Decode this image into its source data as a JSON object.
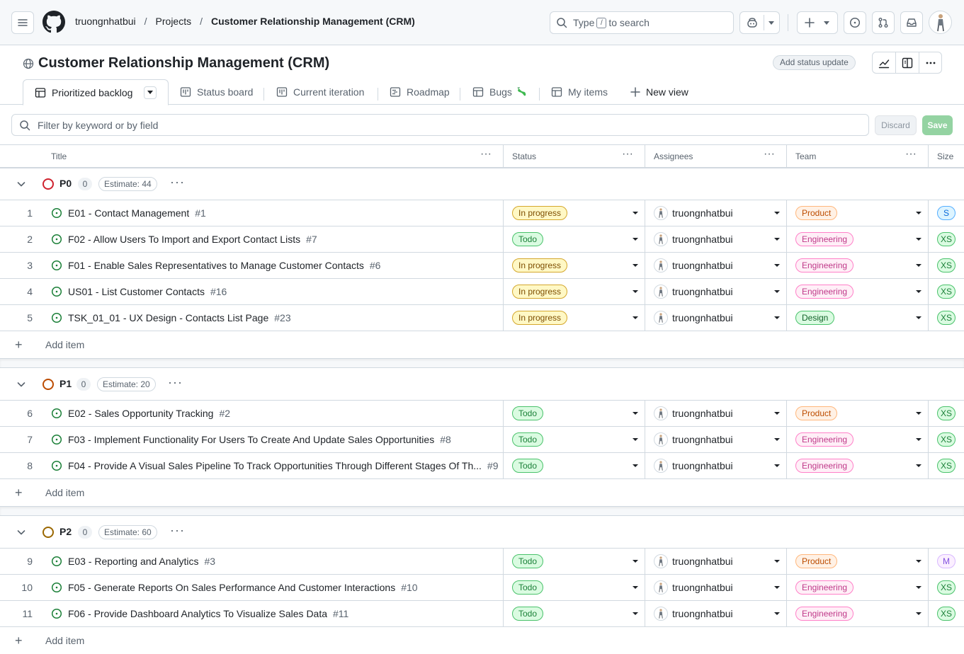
{
  "header": {
    "breadcrumb": {
      "owner": "truongnhatbui",
      "projects": "Projects",
      "project": "Customer Relationship Management (CRM)"
    },
    "search": {
      "prefix": "Type",
      "key": "/",
      "suffix": "to search"
    }
  },
  "project": {
    "title": "Customer Relationship Management (CRM)",
    "status_update": "Add status update"
  },
  "tabs": [
    {
      "label": "Prioritized backlog",
      "active": true
    },
    {
      "label": "Status board"
    },
    {
      "label": "Current iteration"
    },
    {
      "label": "Roadmap"
    },
    {
      "label": "Bugs"
    },
    {
      "label": "My items"
    },
    {
      "label": "New view"
    }
  ],
  "filter": {
    "placeholder": "Filter by keyword or by field",
    "discard": "Discard",
    "save": "Save"
  },
  "columns": {
    "title": "Title",
    "status": "Status",
    "assignees": "Assignees",
    "team": "Team",
    "size": "Size"
  },
  "add_item_label": "Add item",
  "colors": {
    "p0": "#cf222e",
    "p1": "#bc4c00",
    "p2": "#9a6700",
    "open_issue": "#1a7f37"
  },
  "groups": [
    {
      "name": "P0",
      "count": "0",
      "estimate": "Estimate: 44",
      "rows": [
        {
          "num": "1",
          "title": "E01 - Contact Management",
          "issue": "#1",
          "status": "In progress",
          "assignee": "truongnhatbui",
          "team": "Product",
          "size": "S"
        },
        {
          "num": "2",
          "title": "F02 - Allow Users To Import and Export Contact Lists",
          "issue": "#7",
          "status": "Todo",
          "assignee": "truongnhatbui",
          "team": "Engineering",
          "size": "XS"
        },
        {
          "num": "3",
          "title": "F01 - Enable Sales Representatives to Manage Customer Contacts",
          "issue": "#6",
          "status": "In progress",
          "assignee": "truongnhatbui",
          "team": "Engineering",
          "size": "XS"
        },
        {
          "num": "4",
          "title": "US01 - List Customer Contacts",
          "issue": "#16",
          "status": "In progress",
          "assignee": "truongnhatbui",
          "team": "Engineering",
          "size": "XS"
        },
        {
          "num": "5",
          "title": "TSK_01_01 - UX Design - Contacts List Page",
          "issue": "#23",
          "status": "In progress",
          "assignee": "truongnhatbui",
          "team": "Design",
          "size": "XS"
        }
      ]
    },
    {
      "name": "P1",
      "count": "0",
      "estimate": "Estimate: 20",
      "rows": [
        {
          "num": "6",
          "title": "E02 - Sales Opportunity Tracking",
          "issue": "#2",
          "status": "Todo",
          "assignee": "truongnhatbui",
          "team": "Product",
          "size": "XS"
        },
        {
          "num": "7",
          "title": "F03 - Implement Functionality For Users To Create And Update Sales Opportunities",
          "issue": "#8",
          "status": "Todo",
          "assignee": "truongnhatbui",
          "team": "Engineering",
          "size": "XS"
        },
        {
          "num": "8",
          "title": "F04 - Provide A Visual Sales Pipeline To Track Opportunities Through Different Stages Of Th...",
          "issue": "#9",
          "status": "Todo",
          "assignee": "truongnhatbui",
          "team": "Engineering",
          "size": "XS"
        }
      ]
    },
    {
      "name": "P2",
      "count": "0",
      "estimate": "Estimate: 60",
      "rows": [
        {
          "num": "9",
          "title": "E03 - Reporting and Analytics",
          "issue": "#3",
          "status": "Todo",
          "assignee": "truongnhatbui",
          "team": "Product",
          "size": "M"
        },
        {
          "num": "10",
          "title": "F05 - Generate Reports On Sales Performance And Customer Interactions",
          "issue": "#10",
          "status": "Todo",
          "assignee": "truongnhatbui",
          "team": "Engineering",
          "size": "XS"
        },
        {
          "num": "11",
          "title": "F06 - Provide Dashboard Analytics To Visualize Sales Data",
          "issue": "#11",
          "status": "Todo",
          "assignee": "truongnhatbui",
          "team": "Engineering",
          "size": "XS"
        }
      ]
    }
  ]
}
